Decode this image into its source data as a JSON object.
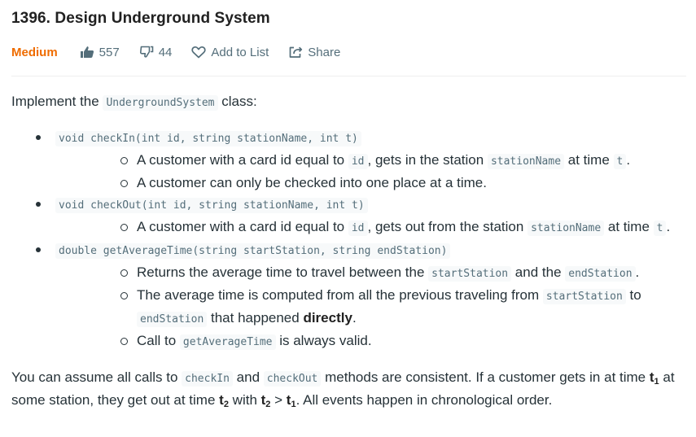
{
  "problem": {
    "title": "1396. Design Underground System",
    "difficulty": "Medium",
    "likes": "557",
    "dislikes": "44",
    "add_to_list": "Add to List",
    "share": "Share"
  },
  "description": {
    "intro_before": "Implement the ",
    "intro_code": "UndergroundSystem",
    "intro_after": " class:",
    "methods": [
      {
        "signature": "void checkIn(int id, string stationName, int t)",
        "bullets": [
          {
            "t1": "A customer with a card id equal to ",
            "c1": "id",
            "t2": ", gets in the station ",
            "c2": "stationName",
            "t3": " at time ",
            "c3": "t",
            "t4": "."
          },
          {
            "text": "A customer can only be checked into one place at a time."
          }
        ]
      },
      {
        "signature": "void checkOut(int id, string stationName, int t)",
        "bullets": [
          {
            "t1": "A customer with a card id equal to ",
            "c1": "id",
            "t2": ", gets out from the station ",
            "c2": "stationName",
            "t3": " at time ",
            "c3": "t",
            "t4": "."
          }
        ]
      },
      {
        "signature": "double getAverageTime(string startStation, string endStation)",
        "bullets": [
          {
            "t1": "Returns the average time to travel between the ",
            "c1": "startStation",
            "t2": " and the ",
            "c2": "endStation",
            "t3": "."
          },
          {
            "t1": "The average time is computed from all the previous traveling from ",
            "c1": "startStation",
            "t2": " to ",
            "c2": "endStation",
            "t3": " that happened ",
            "b1": "directly",
            "t4": "."
          },
          {
            "t1": "Call to ",
            "c1": "getAverageTime",
            "t2": " is always valid."
          }
        ]
      }
    ],
    "closing": {
      "t1": "You can assume all calls to ",
      "c1": "checkIn",
      "t2": " and ",
      "c2": "checkOut",
      "t3": " methods are consistent. If a customer gets in at time ",
      "b1": "t",
      "sub1": "1",
      "t4": " at some station, they get out at time ",
      "b2": "t",
      "sub2": "2",
      "t5": " with ",
      "b3": "t",
      "sub3": "2",
      "t6": " > ",
      "b4": "t",
      "sub4": "1",
      "t7": ". All events happen in chronological order."
    }
  },
  "colors": {
    "difficulty_medium": "#ef6c00",
    "meta_text": "#546e7a",
    "code_bg": "#f7f9fa"
  },
  "icons": [
    "thumbs-up-icon",
    "thumbs-down-icon",
    "heart-icon",
    "share-icon"
  ]
}
